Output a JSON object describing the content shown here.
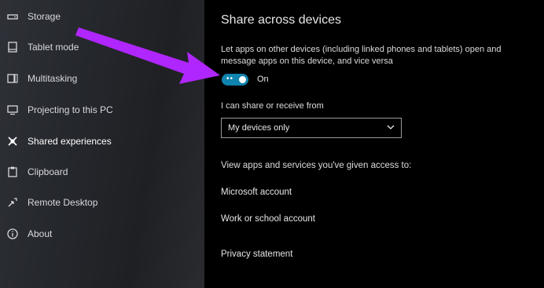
{
  "sidebar": {
    "items": [
      {
        "label": "Storage",
        "icon": "storage-icon"
      },
      {
        "label": "Tablet mode",
        "icon": "tablet-mode-icon"
      },
      {
        "label": "Multitasking",
        "icon": "multitasking-icon"
      },
      {
        "label": "Projecting to this PC",
        "icon": "projecting-icon"
      },
      {
        "label": "Shared experiences",
        "icon": "shared-experiences-icon"
      },
      {
        "label": "Clipboard",
        "icon": "clipboard-icon"
      },
      {
        "label": "Remote Desktop",
        "icon": "remote-desktop-icon"
      },
      {
        "label": "About",
        "icon": "about-icon"
      }
    ],
    "active_index": 4
  },
  "main": {
    "title": "Share across devices",
    "description": "Let apps on other devices (including linked phones and tablets) open and message apps on this device, and vice versa",
    "toggle": {
      "state_label": "On",
      "on": true,
      "color": "#0f84ae"
    },
    "share_label": "I can share or receive from",
    "dropdown_value": "My devices only",
    "view_text": "View apps and services you've given access to:",
    "links": {
      "microsoft_account": "Microsoft account",
      "work_school_account": "Work or school account",
      "privacy_statement": "Privacy statement"
    }
  },
  "annotation": {
    "color": "#b026ff",
    "icon": "pointer-arrow"
  }
}
